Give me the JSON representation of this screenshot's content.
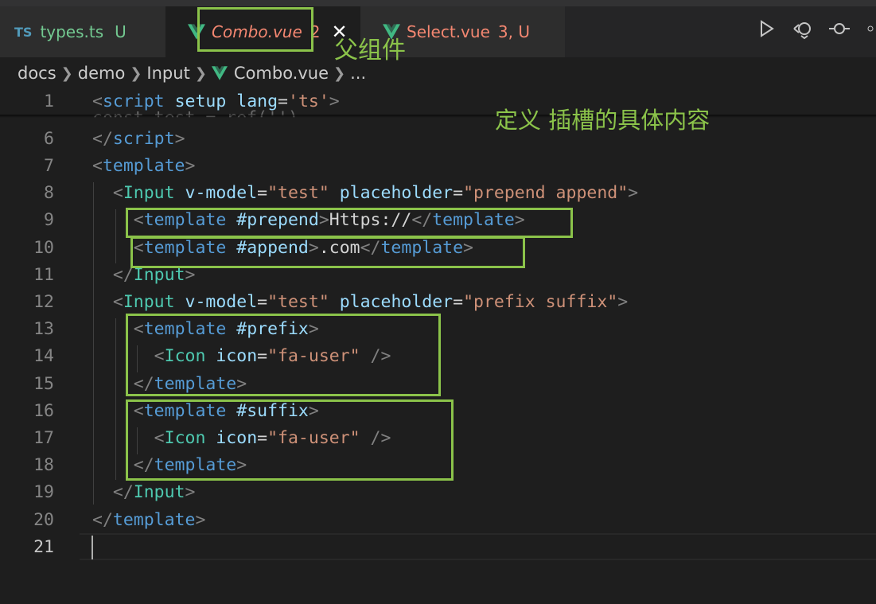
{
  "tabs": [
    {
      "badge": "TS",
      "name": "types.ts",
      "status": "U"
    },
    {
      "name": "Combo.vue",
      "problems": "2",
      "close": "✕"
    },
    {
      "name": "Select.vue",
      "status": "3, U"
    }
  ],
  "breadcrumb": [
    "docs",
    "demo",
    "Input",
    "Combo.vue",
    "..."
  ],
  "annotations": {
    "parent_component": "父组件",
    "define_slot_content": "定义 插槽的具体内容"
  },
  "ghost_line": "const test = ref('')",
  "lines": [
    {
      "n": "1",
      "tokens": [
        [
          "t-punc",
          "<"
        ],
        [
          "t-tag",
          "script"
        ],
        [
          "t-text",
          " "
        ],
        [
          "t-attr",
          "setup"
        ],
        [
          "t-text",
          " "
        ],
        [
          "t-attr",
          "lang"
        ],
        [
          "t-eq",
          "="
        ],
        [
          "t-str",
          "'ts'"
        ],
        [
          "t-punc",
          ">"
        ]
      ]
    },
    {
      "n": "6",
      "tokens": [
        [
          "t-punc",
          "</"
        ],
        [
          "t-tag",
          "script"
        ],
        [
          "t-punc",
          ">"
        ]
      ]
    },
    {
      "n": "7",
      "tokens": [
        [
          "t-punc",
          "<"
        ],
        [
          "t-tag",
          "template"
        ],
        [
          "t-punc",
          ">"
        ]
      ]
    },
    {
      "n": "8",
      "tokens": [
        [
          "t-text",
          "  "
        ],
        [
          "t-punc",
          "<"
        ],
        [
          "t-comp",
          "Input"
        ],
        [
          "t-text",
          " "
        ],
        [
          "t-attr",
          "v-model"
        ],
        [
          "t-eq",
          "="
        ],
        [
          "t-str",
          "\"test\""
        ],
        [
          "t-text",
          " "
        ],
        [
          "t-attr",
          "placeholder"
        ],
        [
          "t-eq",
          "="
        ],
        [
          "t-str",
          "\"prepend append\""
        ],
        [
          "t-punc",
          ">"
        ]
      ]
    },
    {
      "n": "9",
      "tokens": [
        [
          "t-text",
          "    "
        ],
        [
          "t-punc",
          "<"
        ],
        [
          "t-tag",
          "template"
        ],
        [
          "t-text",
          " "
        ],
        [
          "t-slot",
          "#prepend"
        ],
        [
          "t-punc",
          ">"
        ],
        [
          "t-text",
          "Https://"
        ],
        [
          "t-punc",
          "</"
        ],
        [
          "t-tag",
          "template"
        ],
        [
          "t-punc",
          ">"
        ]
      ]
    },
    {
      "n": "10",
      "tokens": [
        [
          "t-text",
          "    "
        ],
        [
          "t-punc",
          "<"
        ],
        [
          "t-tag",
          "template"
        ],
        [
          "t-text",
          " "
        ],
        [
          "t-slot",
          "#append"
        ],
        [
          "t-punc",
          ">"
        ],
        [
          "t-text",
          ".com"
        ],
        [
          "t-punc",
          "</"
        ],
        [
          "t-tag",
          "template"
        ],
        [
          "t-punc",
          ">"
        ]
      ]
    },
    {
      "n": "11",
      "tokens": [
        [
          "t-text",
          "  "
        ],
        [
          "t-punc",
          "</"
        ],
        [
          "t-comp",
          "Input"
        ],
        [
          "t-punc",
          ">"
        ]
      ]
    },
    {
      "n": "12",
      "tokens": [
        [
          "t-text",
          "  "
        ],
        [
          "t-punc",
          "<"
        ],
        [
          "t-comp",
          "Input"
        ],
        [
          "t-text",
          " "
        ],
        [
          "t-attr",
          "v-model"
        ],
        [
          "t-eq",
          "="
        ],
        [
          "t-str",
          "\"test\""
        ],
        [
          "t-text",
          " "
        ],
        [
          "t-attr",
          "placeholder"
        ],
        [
          "t-eq",
          "="
        ],
        [
          "t-str",
          "\"prefix suffix\""
        ],
        [
          "t-punc",
          ">"
        ]
      ]
    },
    {
      "n": "13",
      "tokens": [
        [
          "t-text",
          "    "
        ],
        [
          "t-punc",
          "<"
        ],
        [
          "t-tag",
          "template"
        ],
        [
          "t-text",
          " "
        ],
        [
          "t-slot",
          "#prefix"
        ],
        [
          "t-punc",
          ">"
        ]
      ]
    },
    {
      "n": "14",
      "tokens": [
        [
          "t-text",
          "      "
        ],
        [
          "t-punc",
          "<"
        ],
        [
          "t-comp",
          "Icon"
        ],
        [
          "t-text",
          " "
        ],
        [
          "t-attr",
          "icon"
        ],
        [
          "t-eq",
          "="
        ],
        [
          "t-str",
          "\"fa-user\""
        ],
        [
          "t-text",
          " "
        ],
        [
          "t-punc",
          "/>"
        ]
      ]
    },
    {
      "n": "15",
      "tokens": [
        [
          "t-text",
          "    "
        ],
        [
          "t-punc",
          "</"
        ],
        [
          "t-tag",
          "template"
        ],
        [
          "t-punc",
          ">"
        ]
      ]
    },
    {
      "n": "16",
      "tokens": [
        [
          "t-text",
          "    "
        ],
        [
          "t-punc",
          "<"
        ],
        [
          "t-tag",
          "template"
        ],
        [
          "t-text",
          " "
        ],
        [
          "t-slot",
          "#suffix"
        ],
        [
          "t-punc",
          ">"
        ]
      ]
    },
    {
      "n": "17",
      "tokens": [
        [
          "t-text",
          "      "
        ],
        [
          "t-punc",
          "<"
        ],
        [
          "t-comp",
          "Icon"
        ],
        [
          "t-text",
          " "
        ],
        [
          "t-attr",
          "icon"
        ],
        [
          "t-eq",
          "="
        ],
        [
          "t-str",
          "\"fa-user\""
        ],
        [
          "t-text",
          " "
        ],
        [
          "t-punc",
          "/>"
        ]
      ]
    },
    {
      "n": "18",
      "tokens": [
        [
          "t-text",
          "    "
        ],
        [
          "t-punc",
          "</"
        ],
        [
          "t-tag",
          "template"
        ],
        [
          "t-punc",
          ">"
        ]
      ]
    },
    {
      "n": "19",
      "tokens": [
        [
          "t-text",
          "  "
        ],
        [
          "t-punc",
          "</"
        ],
        [
          "t-comp",
          "Input"
        ],
        [
          "t-punc",
          ">"
        ]
      ]
    },
    {
      "n": "20",
      "tokens": [
        [
          "t-punc",
          "</"
        ],
        [
          "t-tag",
          "template"
        ],
        [
          "t-punc",
          ">"
        ]
      ]
    },
    {
      "n": "21",
      "tokens": []
    }
  ]
}
